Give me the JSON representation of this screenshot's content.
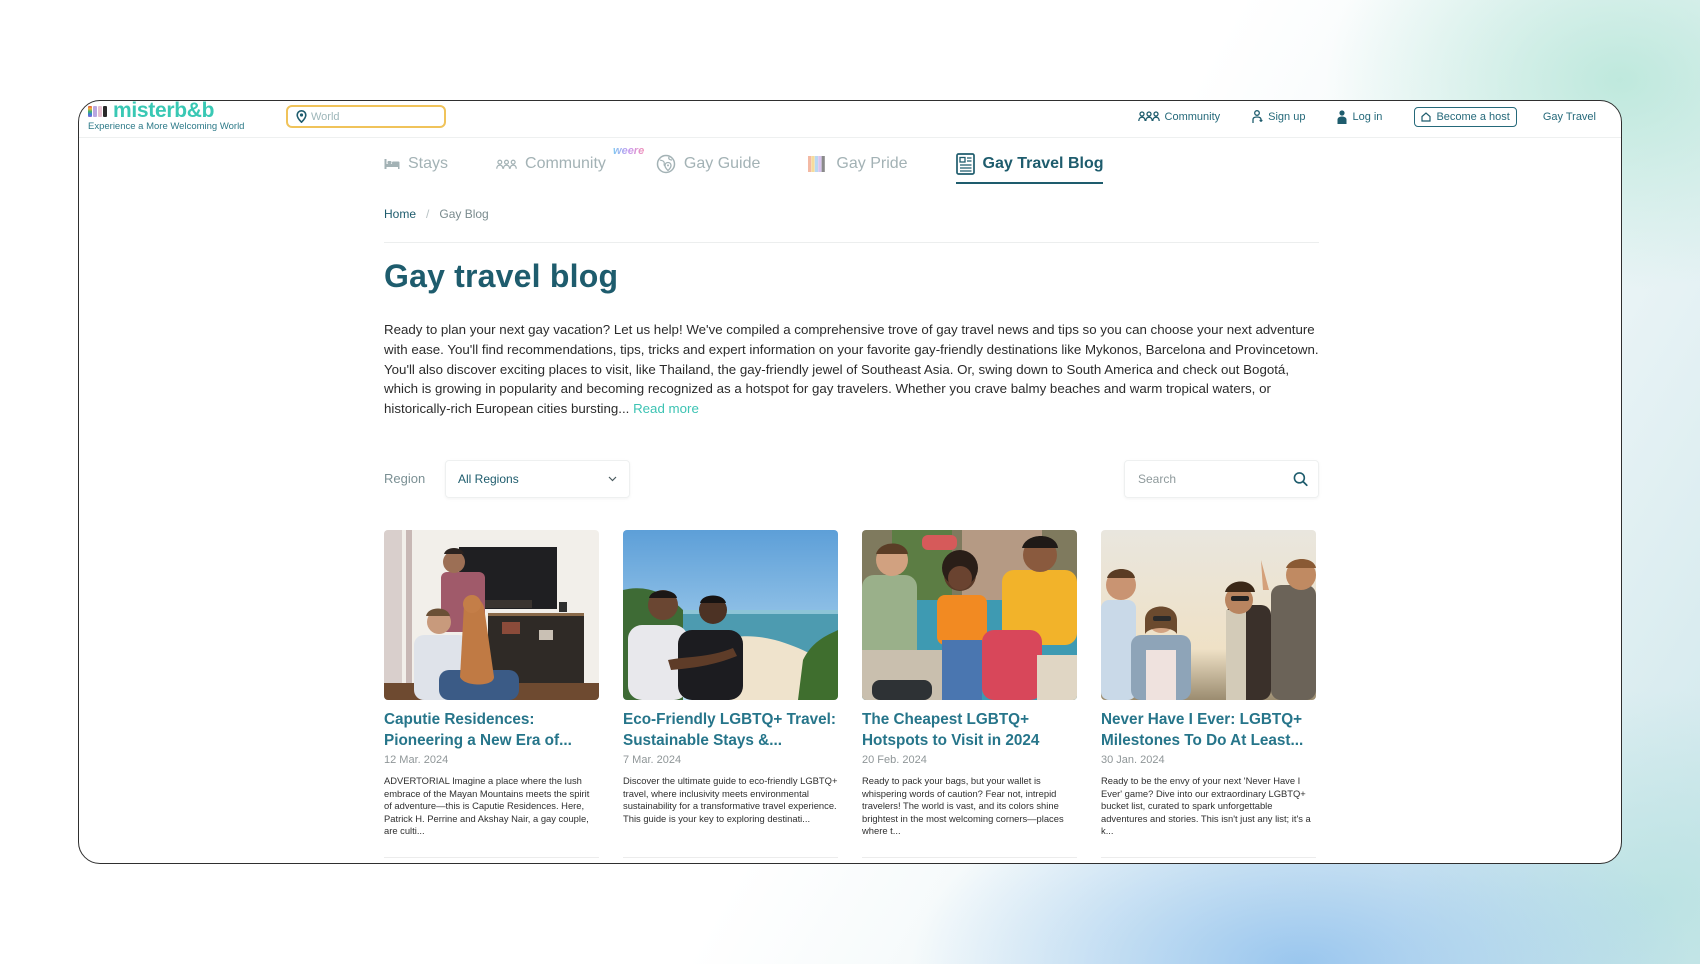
{
  "brand": {
    "name": "misterb&b",
    "tagline": "Experience a More Welcoming World",
    "stripe_colors": [
      "#e0523c",
      "#f2b33d",
      "#8a6cd0",
      "#c9c9c9",
      "#e6c0d0",
      "#2a2a2a"
    ],
    "accent_color": "#39c8b4",
    "primary_color": "#1e5c6d",
    "location_placeholder": "World"
  },
  "top_nav": {
    "community": "Community",
    "sign_up": "Sign up",
    "log_in": "Log in",
    "become_host": "Become a host",
    "gay_travel": "Gay Travel"
  },
  "main_nav": {
    "tabs": [
      {
        "label": "Stays",
        "icon": "bed-icon",
        "active": false
      },
      {
        "label": "Community",
        "icon": "community-icon",
        "badge": "weere",
        "active": false
      },
      {
        "label": "Gay Guide",
        "icon": "globe-pin-icon",
        "active": false
      },
      {
        "label": "Gay Pride",
        "icon": "pride-flag-icon",
        "active": false
      },
      {
        "label": "Gay Travel Blog",
        "icon": "newspaper-icon",
        "active": true
      }
    ]
  },
  "breadcrumb": {
    "home": "Home",
    "separator": "/",
    "current": "Gay Blog"
  },
  "page": {
    "title": "Gay travel blog",
    "intro": "Ready to plan your next gay vacation? Let us help! We've compiled a comprehensive trove of gay travel news and tips so you can choose your next adventure with ease. You'll find recommendations, tips, tricks and expert information on your favorite gay-friendly destinations like Mykonos, Barcelona and Provincetown. You'll also discover exciting places to visit, like Thailand, the gay-friendly jewel of Southeast Asia. Or, swing down to South America and check out Bogotá, which is growing in popularity and becoming recognized as a hotspot for gay travelers. Whether you crave balmy beaches and warm tropical waters, or historically-rich European cities bursting...",
    "read_more": "Read more"
  },
  "filters": {
    "region_label": "Region",
    "region_value": "All Regions",
    "search_placeholder": "Search"
  },
  "posts": [
    {
      "title": "Caputie Residences: Pioneering a New Era of...",
      "date": "12 Mar. 2024",
      "excerpt": "ADVERTORIAL Imagine a place where the lush embrace of the Mayan Mountains meets the spirit of adventure—this is Caputie Residences. Here, Patrick H. Perrine and Akshay Nair, a gay couple, are culti...",
      "image": "two men with a dog in a living room"
    },
    {
      "title": "Eco-Friendly LGBTQ+ Travel: Sustainable Stays &...",
      "date": "7 Mar. 2024",
      "excerpt": "Discover the ultimate guide to eco-friendly LGBTQ+ travel, where inclusivity meets environmental sustainability for a transformative travel experience. This guide is your key to exploring destinati...",
      "image": "two men embracing overlooking a beach"
    },
    {
      "title": "The Cheapest LGBTQ+ Hotspots to Visit in 2024",
      "date": "20 Feb. 2024",
      "excerpt": "Ready to pack your bags, but your wallet is whispering words of caution? Fear not, intrepid travelers! The world is vast, and its colors shine brightest in the most welcoming corners—places where t...",
      "image": "three friends sitting with backpacks"
    },
    {
      "title": "Never Have I Ever: LGBTQ+ Milestones To Do At Least...",
      "date": "30 Jan. 2024",
      "excerpt": "Ready to be the envy of your next 'Never Have I Ever' game? Dive into our extraordinary LGBTQ+ bucket list, curated to spark unforgettable adventures and stories. This isn't just any list; it's a k...",
      "image": "group of friends laughing outdoors at sunset"
    }
  ]
}
